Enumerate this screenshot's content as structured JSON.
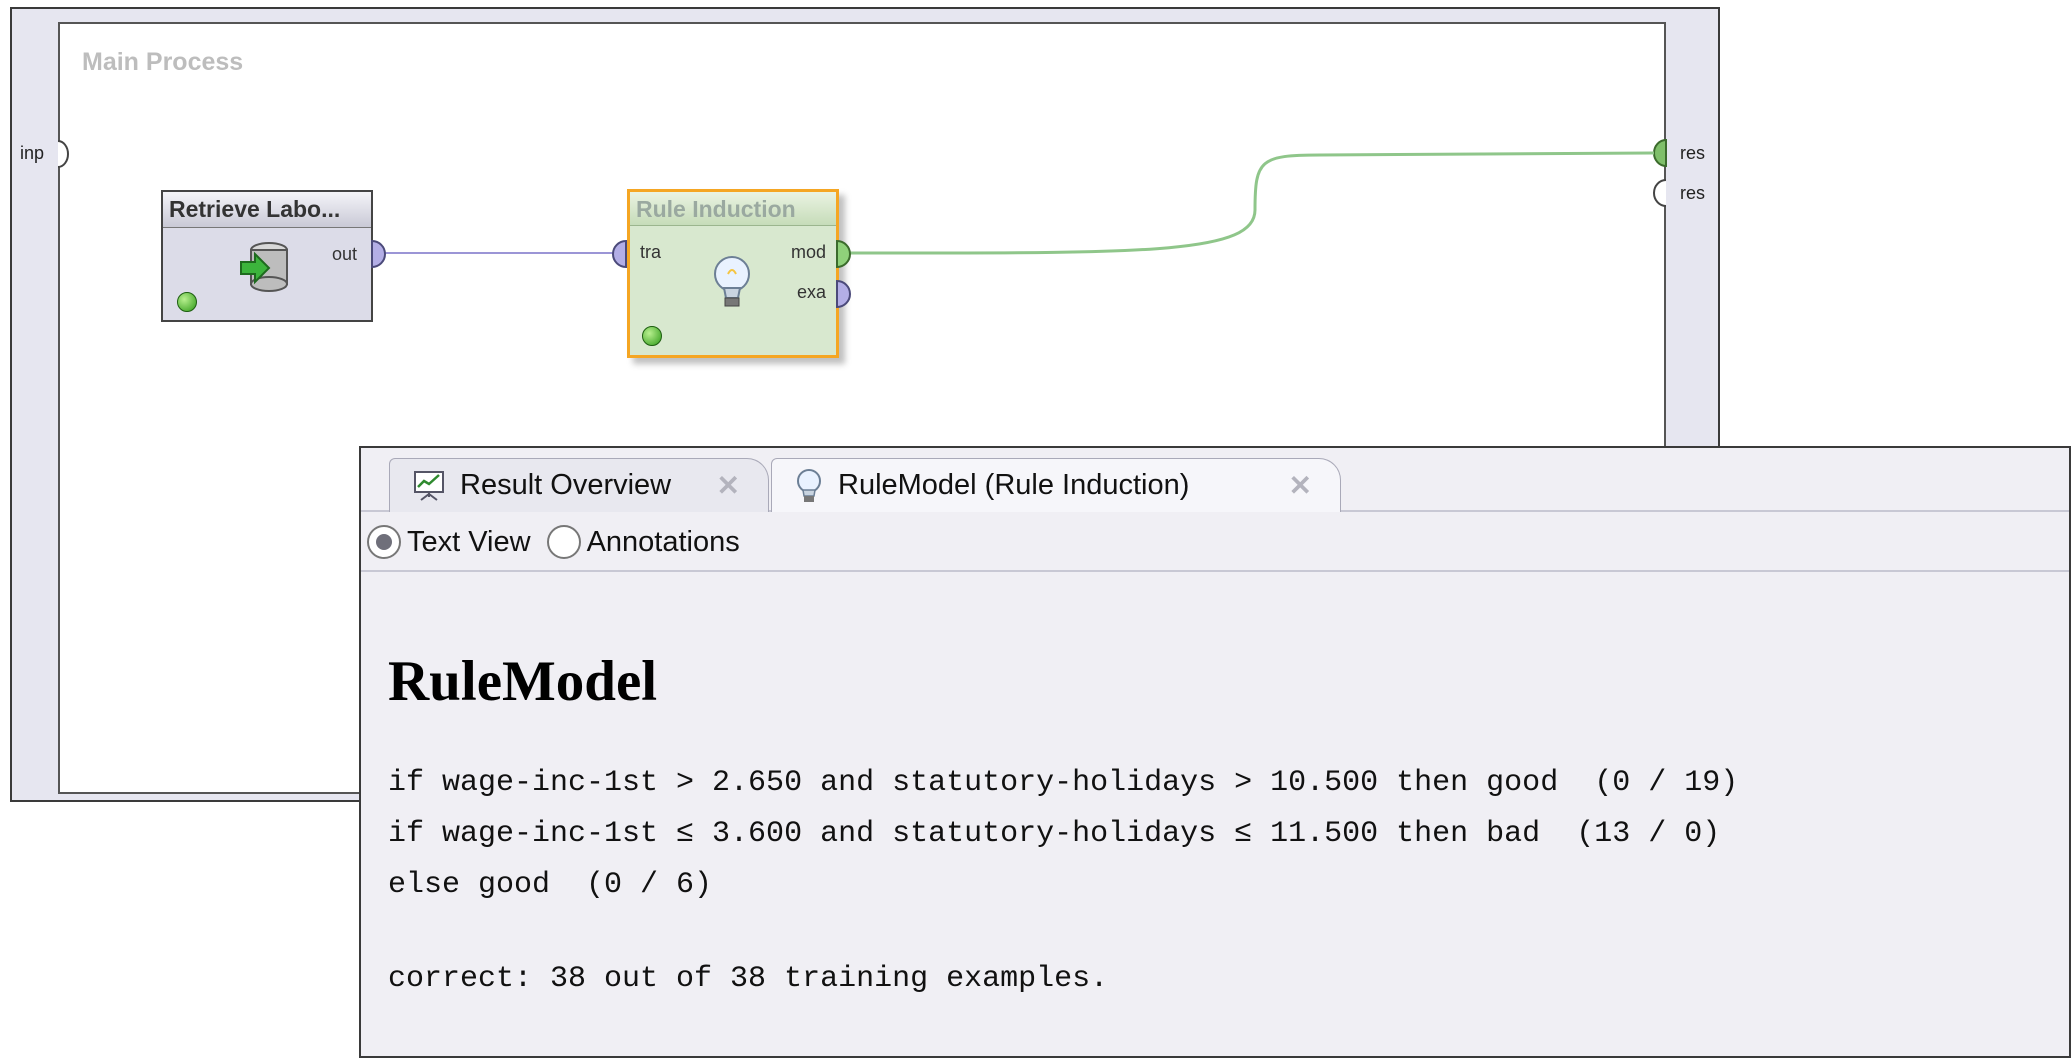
{
  "process": {
    "title": "Main Process",
    "input_port": "inp",
    "output_ports": [
      "res",
      "res"
    ]
  },
  "operators": {
    "retrieve": {
      "title": "Retrieve Labo...",
      "out_port": "out",
      "icon": "database-retrieve-icon",
      "status_color": "#2f9a18"
    },
    "rule_induction": {
      "title": "Rule Induction",
      "in_port": "tra",
      "out_ports": [
        "mod",
        "exa"
      ],
      "icon": "lightbulb-icon",
      "status_color": "#2f9a18"
    }
  },
  "results": {
    "tabs": [
      {
        "label": "Result Overview",
        "icon": "chart-presentation-icon"
      },
      {
        "label": "RuleModel (Rule Induction)",
        "icon": "lightbulb-icon"
      }
    ],
    "views": [
      {
        "label": "Text View",
        "checked": true
      },
      {
        "label": "Annotations",
        "checked": false
      }
    ],
    "model_title": "RuleModel",
    "rules": [
      "if wage-inc-1st > 2.650 and statutory-holidays > 10.500 then good  (0 / 19)",
      "if wage-inc-1st ≤ 3.600 and statutory-holidays ≤ 11.500 then bad  (13 / 0)",
      "else good  (0 / 6)"
    ],
    "summary": "correct: 38 out of 38 training examples."
  },
  "colors": {
    "selected_operator_border": "#f5a623",
    "model_wire": "#8fc68a",
    "data_wire": "#9b95d6"
  }
}
